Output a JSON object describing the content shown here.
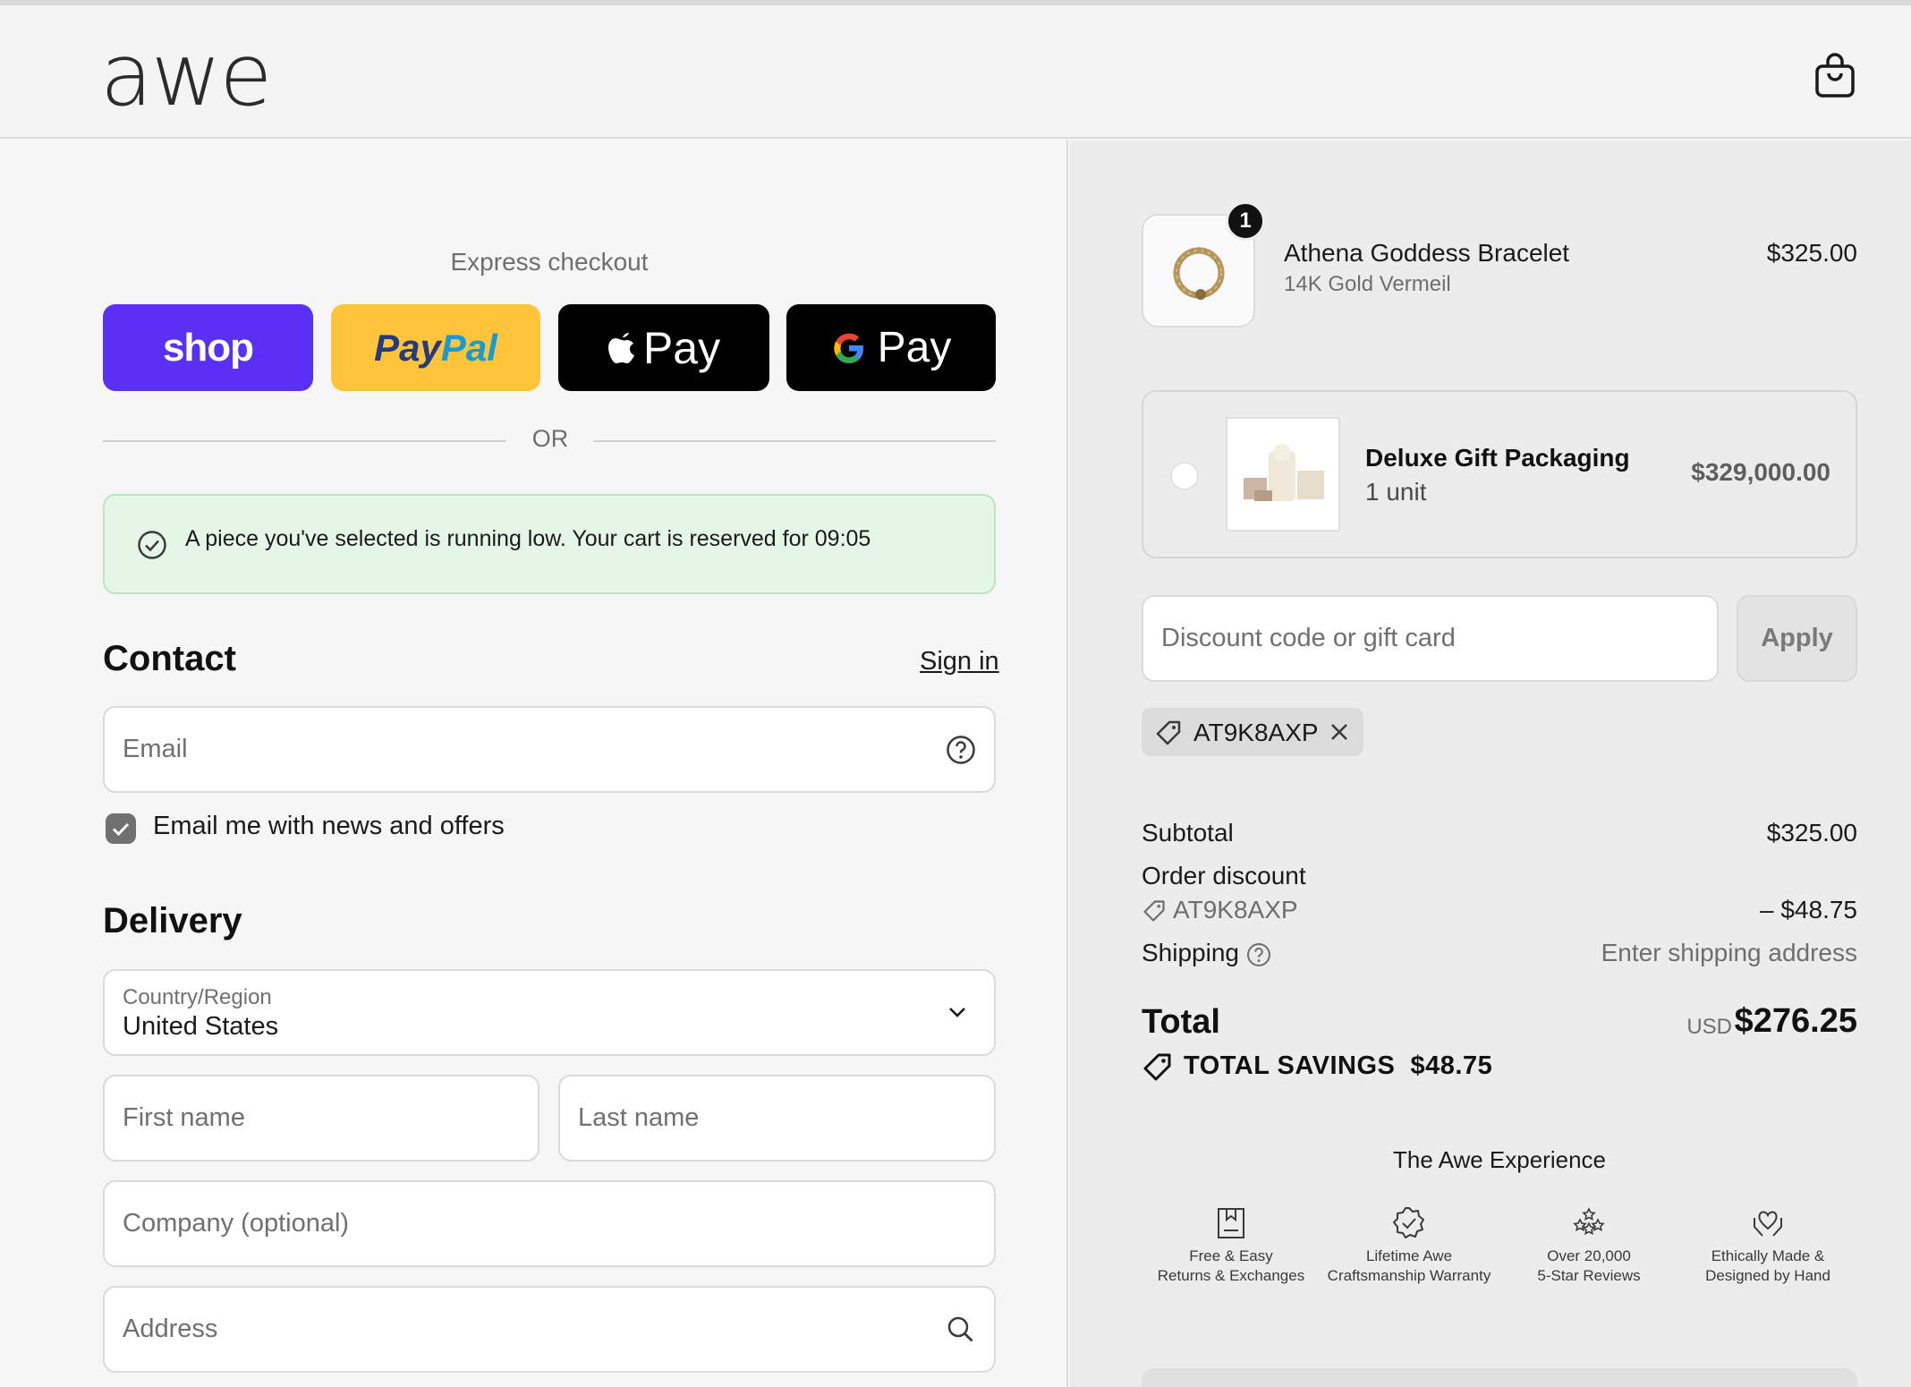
{
  "header": {
    "logo": "awe",
    "cart_icon": "shopping-bag-icon"
  },
  "express": {
    "title": "Express checkout",
    "shop_label": "shop",
    "paypal_label_1": "Pay",
    "paypal_label_2": "Pal",
    "apple_pay_label": "Pay",
    "google_pay_label": "Pay",
    "or_label": "OR"
  },
  "notice": {
    "text": "A piece you've selected is running low. Your cart is reserved for 09:05",
    "color": "#e5f6e6"
  },
  "contact": {
    "title": "Contact",
    "sign_in": "Sign in",
    "email_placeholder": "Email",
    "newsletter_label": "Email me with news and offers",
    "newsletter_checked": true
  },
  "delivery": {
    "title": "Delivery",
    "country_label": "Country/Region",
    "country_value": "United States",
    "first_name_placeholder": "First name",
    "last_name_placeholder": "Last name",
    "company_placeholder": "Company (optional)",
    "address_placeholder": "Address"
  },
  "cart": {
    "item": {
      "quantity": "1",
      "title": "Athena Goddess Bracelet",
      "variant": "14K Gold Vermeil",
      "price": "$325.00"
    },
    "upsell": {
      "title": "Deluxe Gift Packaging",
      "subtitle": "1 unit",
      "price": "$329,000.00"
    },
    "discount_placeholder": "Discount code or gift card",
    "apply_label": "Apply",
    "applied_code": "AT9K8AXP"
  },
  "summary": {
    "subtotal_label": "Subtotal",
    "subtotal_value": "$325.00",
    "discount_label": "Order discount",
    "discount_code": "AT9K8AXP",
    "discount_value": "– $48.75",
    "shipping_label": "Shipping",
    "shipping_value": "Enter shipping address",
    "total_label": "Total",
    "total_currency": "USD",
    "total_value": "$276.25",
    "savings_label": "TOTAL SAVINGS",
    "savings_value": "$48.75"
  },
  "experience": {
    "title": "The Awe Experience",
    "items": [
      {
        "line1": "Free & Easy",
        "line2": "Returns & Exchanges",
        "icon": "return-box-icon"
      },
      {
        "line1": "Lifetime Awe",
        "line2": "Craftsmanship Warranty",
        "icon": "warranty-badge-icon"
      },
      {
        "line1": "Over 20,000",
        "line2": "5-Star Reviews",
        "icon": "stars-icon"
      },
      {
        "line1": "Ethically Made &",
        "line2": "Designed by Hand",
        "icon": "heart-hands-icon"
      }
    ]
  },
  "colors": {
    "shop": "#5a31f4",
    "paypal": "#ffc439",
    "apple": "#000000",
    "gpay": "#000000"
  }
}
